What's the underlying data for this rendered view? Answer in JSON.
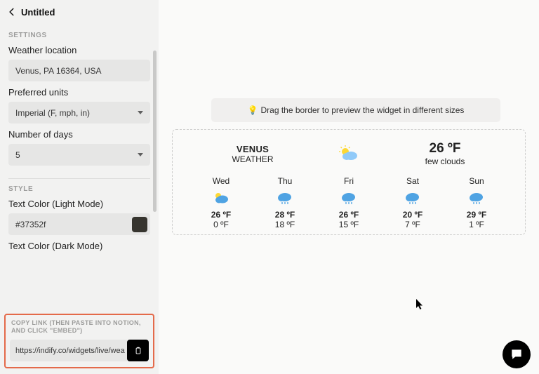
{
  "header": {
    "title": "Untitled"
  },
  "sections": {
    "settings_head": "SETTINGS",
    "style_head": "STYLE"
  },
  "fields": {
    "weather_location": {
      "label": "Weather location",
      "value": "Venus, PA 16364, USA"
    },
    "preferred_units": {
      "label": "Preferred units",
      "value": "Imperial (F, mph, in)"
    },
    "number_of_days": {
      "label": "Number of days",
      "value": "5"
    },
    "text_color_light": {
      "label": "Text Color (Light Mode)",
      "value": "#37352f",
      "swatch": "#37352f"
    },
    "text_color_dark": {
      "label": "Text Color (Dark Mode)"
    }
  },
  "copy": {
    "label": "COPY LINK (THEN PASTE INTO NOTION, AND CLICK \"EMBED\")",
    "url": "https://indify.co/widgets/live/wea"
  },
  "preview": {
    "hint": "Drag the border to preview the widget in different sizes",
    "location": "VENUS",
    "location_sub": "WEATHER",
    "current_temp": "26 ºF",
    "current_desc": "few clouds",
    "days": [
      {
        "name": "Wed",
        "icon": "sun-cloud",
        "hi": "26 ºF",
        "lo": "0 ºF"
      },
      {
        "name": "Thu",
        "icon": "cloud-rain",
        "hi": "28 ºF",
        "lo": "18 ºF"
      },
      {
        "name": "Fri",
        "icon": "cloud-rain",
        "hi": "26 ºF",
        "lo": "15 ºF"
      },
      {
        "name": "Sat",
        "icon": "cloud-rain",
        "hi": "20 ºF",
        "lo": "7 ºF"
      },
      {
        "name": "Sun",
        "icon": "cloud-rain",
        "hi": "29 ºF",
        "lo": "1 ºF"
      }
    ]
  }
}
